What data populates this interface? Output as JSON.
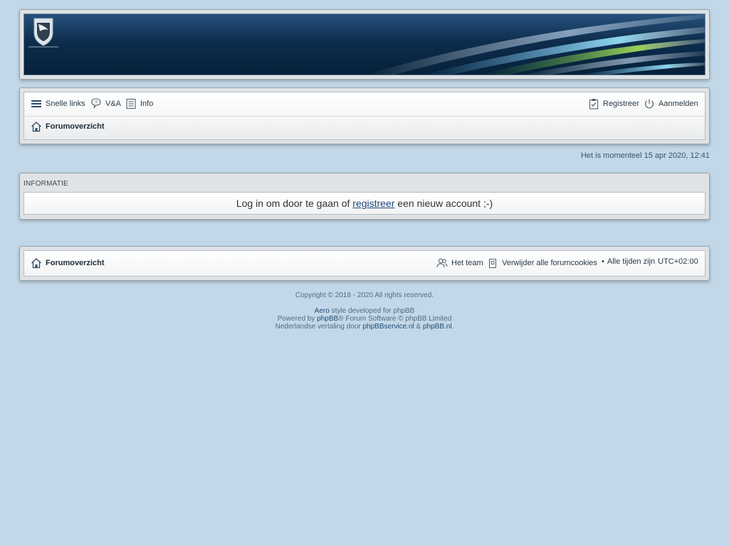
{
  "header": {
    "logo_icon": "shield-logo-icon"
  },
  "nav": {
    "quick_links": "Snelle links",
    "faq": "V&A",
    "info": "Info",
    "register": "Registreer",
    "login": "Aanmelden",
    "forum_index": "Forumoverzicht"
  },
  "time_line": "Het is momenteel 15 apr 2020, 12:41",
  "info_panel": {
    "title": "INFORMATIE",
    "text_before": "Log in om door te gaan of ",
    "link": "registreer",
    "text_after": " een nieuw account ;-)"
  },
  "footer_nav": {
    "forum_index": "Forumoverzicht",
    "team": "Het team",
    "delete_cookies": "Verwijder alle forumcookies",
    "bullet": "•",
    "times_prefix": "Alle tijden zijn",
    "timezone": "UTC+02:00"
  },
  "copyright": {
    "line1": "Copyright © 2018 - 2020 All rights reserved.",
    "aero": "Aero",
    "style_text": " style developed for phpBB",
    "powered_by": "Powered by ",
    "phpbb": "phpBB",
    "forum_software": "® Forum Software © phpBB Limited",
    "translation_prefix": "Nederlandse vertaling door ",
    "phpbbservice": "phpBBservice.nl",
    "amp": " & ",
    "phpbb_nl": "phpBB.nl",
    "period": "."
  },
  "colors": {
    "page_bg": "#c2d8e8",
    "link": "#1d4a77",
    "header_dark": "#06213a"
  }
}
